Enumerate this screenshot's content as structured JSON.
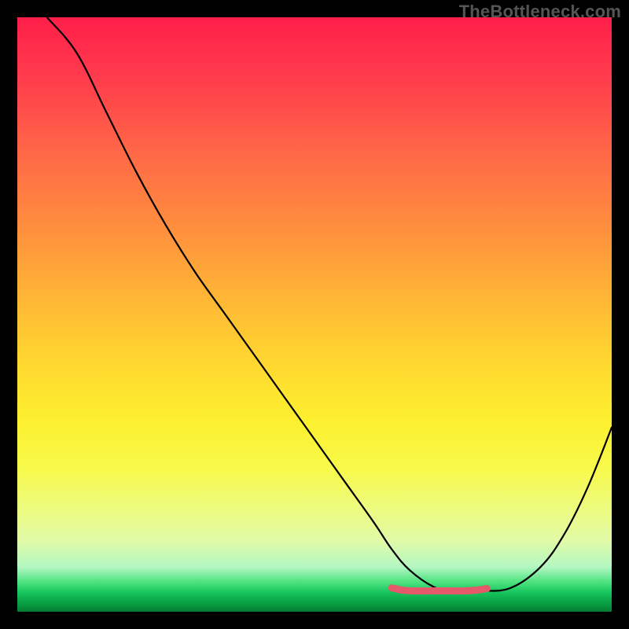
{
  "watermark": "TheBottleneck.com",
  "colors": {
    "black_curve": "#000000",
    "pink_curve": "#e55a6a",
    "frame": "#000000"
  },
  "chart_data": {
    "type": "line",
    "title": "",
    "xlabel": "",
    "ylabel": "",
    "xlim": [
      0,
      100
    ],
    "ylim": [
      0,
      100
    ],
    "grid": false,
    "legend": false,
    "series": [
      {
        "name": "black-curve",
        "color": "#000000",
        "x": [
          5,
          10,
          15,
          20,
          25,
          30,
          35,
          40,
          45,
          50,
          55,
          60,
          63,
          66,
          70,
          73,
          78,
          83,
          88,
          92,
          96,
          100
        ],
        "values": [
          100,
          94,
          84,
          74,
          65,
          57,
          50,
          43,
          36,
          29,
          22,
          15,
          10.5,
          7,
          4.2,
          3.5,
          3.5,
          4.0,
          7.5,
          13,
          21,
          31
        ]
      },
      {
        "name": "pink-floor",
        "color": "#e55a6a",
        "x": [
          63,
          65,
          67,
          70,
          73,
          75,
          77,
          79
        ],
        "values": [
          4.0,
          3.6,
          3.5,
          3.5,
          3.5,
          3.5,
          3.6,
          3.9
        ]
      }
    ],
    "annotations": [
      {
        "text": "TheBottleneck.com",
        "position": "top-right"
      }
    ]
  }
}
